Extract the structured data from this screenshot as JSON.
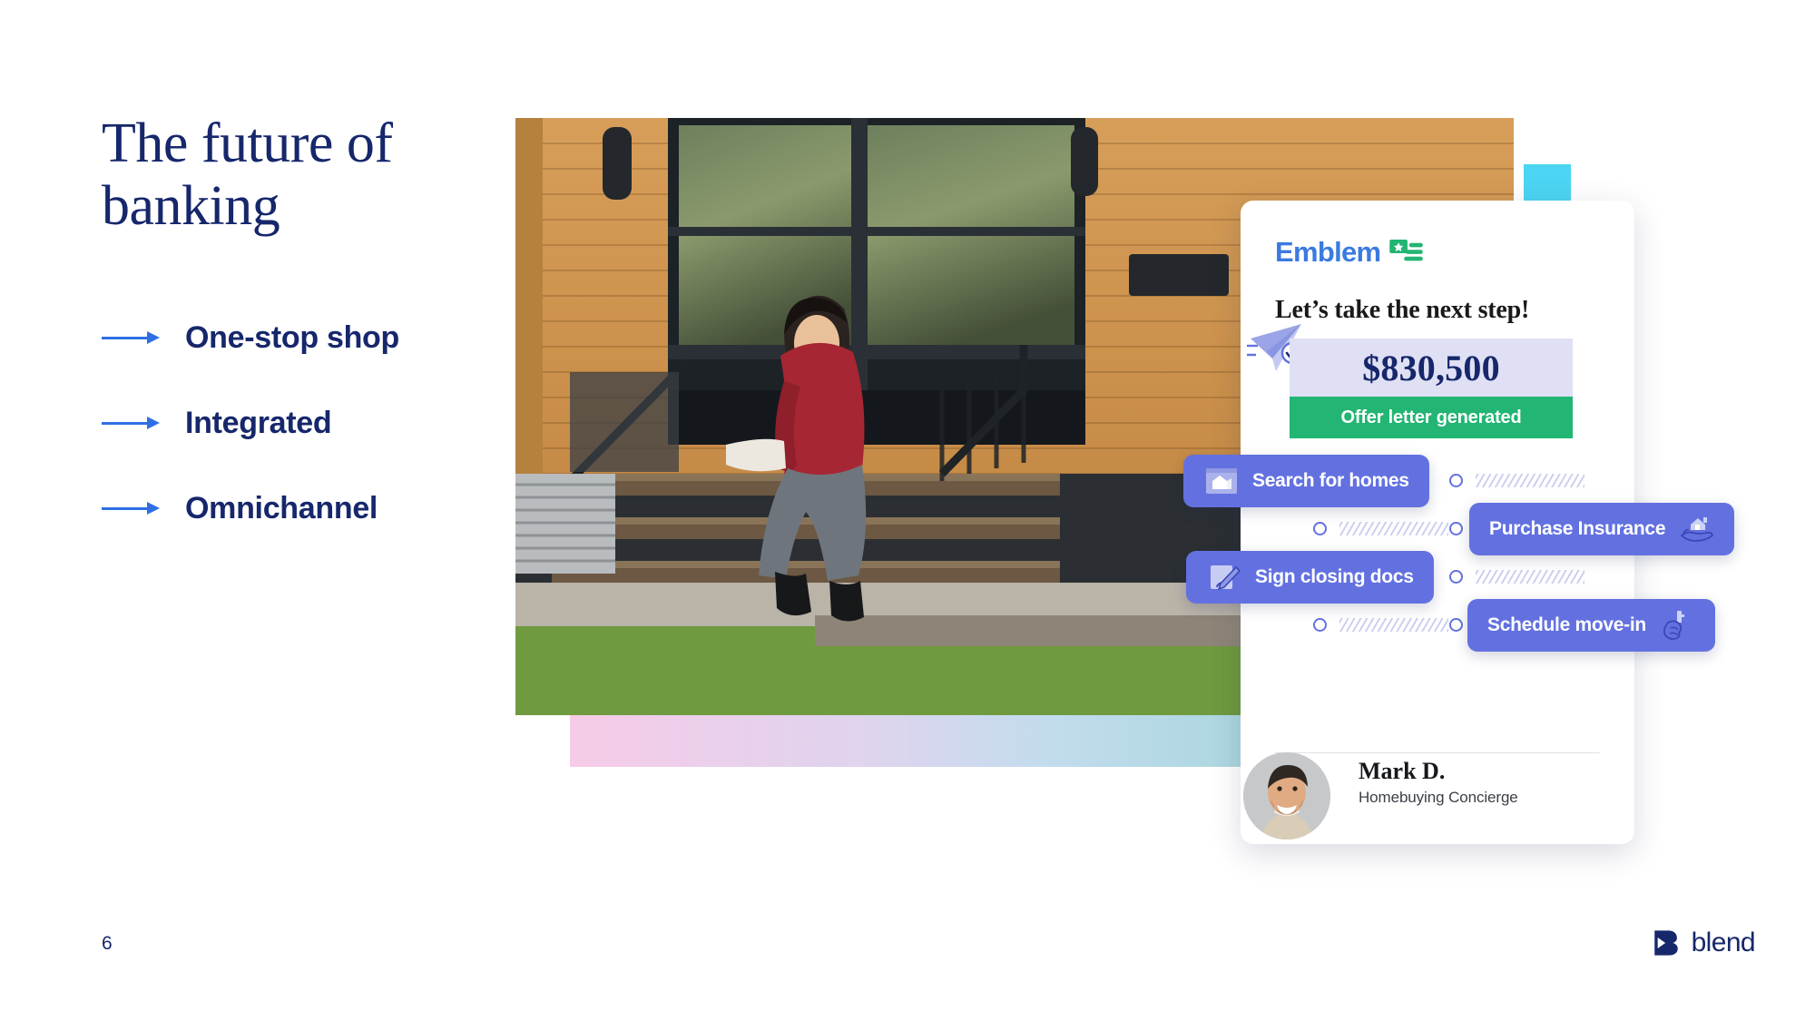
{
  "slide": {
    "title": "The future of banking",
    "page_number": "6",
    "brand": {
      "name": "blend",
      "logo_icon": "blend-b-mark",
      "color": "#16276b"
    },
    "accent_colors": {
      "navy": "#16276b",
      "arrow_blue": "#2f6fe4",
      "cyan_square": "#4cd5f2",
      "chip_indigo": "#6371e0",
      "status_green": "#22b573",
      "price_lavender": "#dfe0f4",
      "emblem_blue": "#3b7ae0",
      "emblem_green": "#22b573"
    },
    "bullets": [
      {
        "label": "One-stop shop",
        "icon": "arrow-right-icon"
      },
      {
        "label": "Integrated",
        "icon": "arrow-right-icon"
      },
      {
        "label": "Omnichannel",
        "icon": "arrow-right-icon"
      }
    ],
    "photo": {
      "alt": "Two women walking down the steps of a modern wood-sided home",
      "decoration_gradient": "pink-to-teal-bar"
    }
  },
  "card": {
    "brand_name": "Emblem",
    "brand_icon": "emblem-flag-icon",
    "heading": "Let’s take the next step!",
    "plane_icon": "paper-plane-check-icon",
    "price": {
      "amount": "$830,500",
      "status": "Offer letter generated"
    },
    "chips": [
      {
        "label": "Search for homes",
        "icon": "house-window-icon",
        "icon_side": "left"
      },
      {
        "label": "Sign closing docs",
        "icon": "document-pen-icon",
        "icon_side": "left"
      },
      {
        "label": "Purchase Insurance",
        "icon": "hand-house-icon",
        "icon_side": "right"
      },
      {
        "label": "Schedule move-in",
        "icon": "hand-key-icon",
        "icon_side": "right"
      }
    ],
    "person": {
      "name": "Mark D.",
      "role": "Homebuying Concierge",
      "avatar_icon": "avatar-photo"
    }
  }
}
